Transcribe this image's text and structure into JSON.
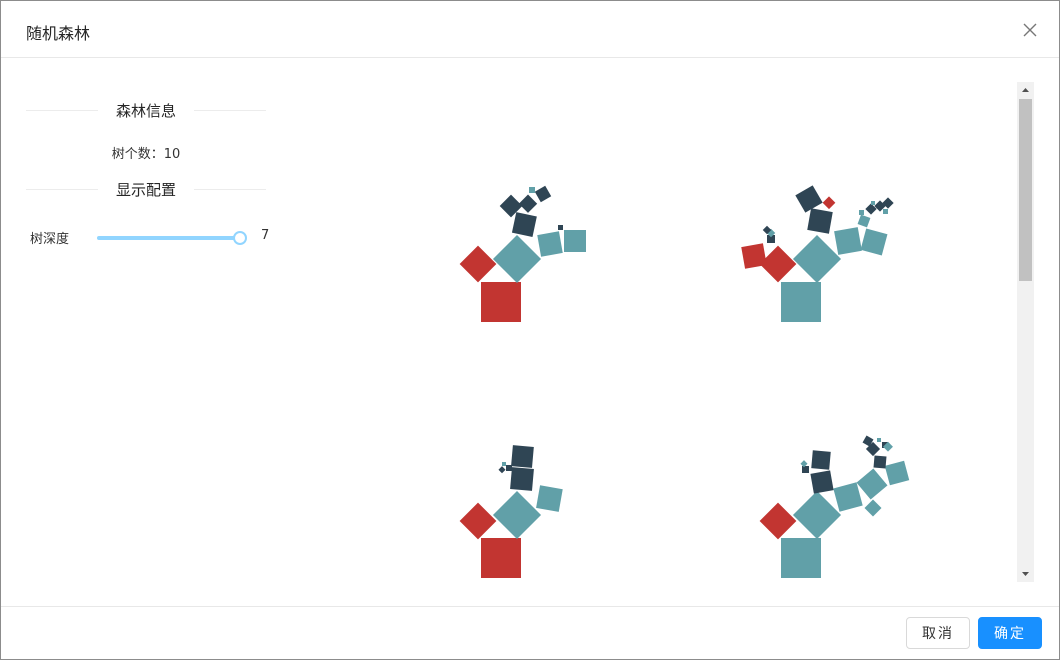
{
  "dialog": {
    "title": "随机森林"
  },
  "sidebar": {
    "forest_info_title": "森林信息",
    "tree_count": "树个数：10",
    "display_title": "显示配置",
    "depth_label": "树深度",
    "depth_value": "7",
    "depth_slider_fraction": 1.0
  },
  "footer": {
    "cancel_label": "取消",
    "ok_label": "确定"
  },
  "colors": {
    "red": "#c23531",
    "teal": "#61a0a8",
    "navy": "#2f4554",
    "primary": "#1890ff",
    "slider": "#91d5ff"
  },
  "icons": {
    "close": "close-icon",
    "scroll_up": "arrow-up-icon",
    "scroll_down": "arrow-down-icon"
  }
}
